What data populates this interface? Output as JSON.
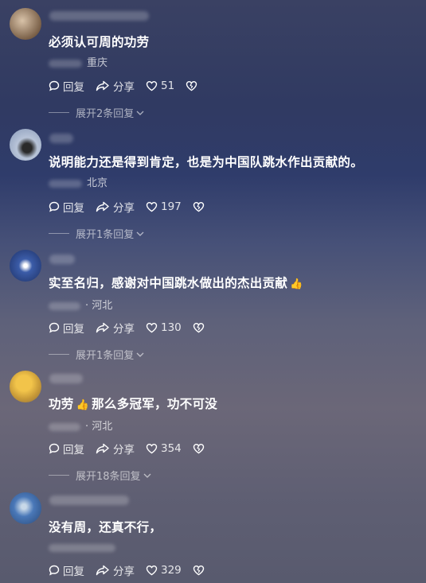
{
  "comments": [
    {
      "text": "必须认可周的功劳",
      "location": "重庆",
      "reply_label": "回复",
      "share_label": "分享",
      "likes": "51",
      "expand_label": "展开2条回复"
    },
    {
      "text": "说明能力还是得到肯定，也是为中国队跳水作出贡献的。",
      "location": "北京",
      "reply_label": "回复",
      "share_label": "分享",
      "likes": "197",
      "expand_label": "展开1条回复"
    },
    {
      "text": "实至名归，感谢对中国跳水做出的杰出贡献",
      "location": "· 河北",
      "reply_label": "回复",
      "share_label": "分享",
      "likes": "130",
      "expand_label": "展开1条回复"
    },
    {
      "text_a": "功劳",
      "text_b": "那么多冠军，功不可没",
      "location": "· 河北",
      "reply_label": "回复",
      "share_label": "分享",
      "likes": "354",
      "expand_label": "展开18条回复"
    },
    {
      "text": "没有周，还真不行，",
      "reply_label": "回复",
      "share_label": "分享",
      "likes": "329"
    }
  ],
  "icons": {
    "reply": "speech-bubble-icon",
    "share": "share-arrow-icon",
    "like": "heart-icon",
    "dislike": "broken-heart-icon",
    "chevron": "chevron-down-icon",
    "thumbs_up": "thumbs-up-emoji"
  },
  "emoji": {
    "thumbs_up": "👍"
  }
}
